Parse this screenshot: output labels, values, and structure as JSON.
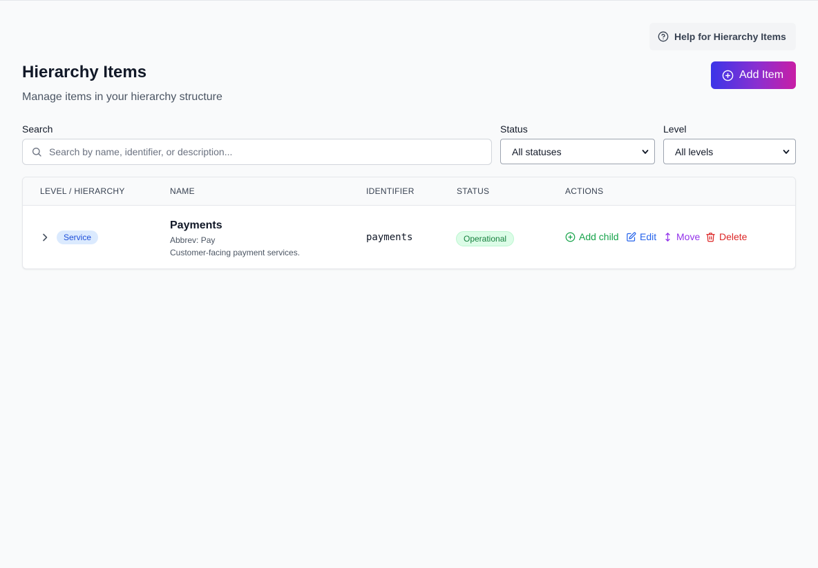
{
  "help": {
    "label": "Help for Hierarchy Items",
    "icon": "help-circle-icon"
  },
  "header": {
    "title": "Hierarchy Items",
    "subtitle": "Manage items in your hierarchy structure",
    "add_label": "Add Item",
    "add_icon": "plus-circle-icon"
  },
  "filters": {
    "search_label": "Search",
    "search_placeholder": "Search by name, identifier, or description...",
    "search_value": "",
    "status_label": "Status",
    "status_value": "All statuses",
    "level_label": "Level",
    "level_value": "All levels"
  },
  "table": {
    "columns": [
      "Level / Hierarchy",
      "Name",
      "Identifier",
      "Status",
      "Actions"
    ],
    "rows": [
      {
        "level": "Service",
        "name": "Payments",
        "abbrev": "Abbrev: Pay",
        "description": "Customer-facing payment services.",
        "identifier": "payments",
        "status": "Operational",
        "actions": {
          "add_child": "Add child",
          "edit": "Edit",
          "move": "Move",
          "delete": "Delete"
        }
      }
    ]
  },
  "colors": {
    "accent_start": "#3b35e8",
    "accent_end": "#c81ea5",
    "add_child": "#16a34a",
    "edit": "#2563eb",
    "move": "#9333ea",
    "delete": "#dc2626"
  }
}
